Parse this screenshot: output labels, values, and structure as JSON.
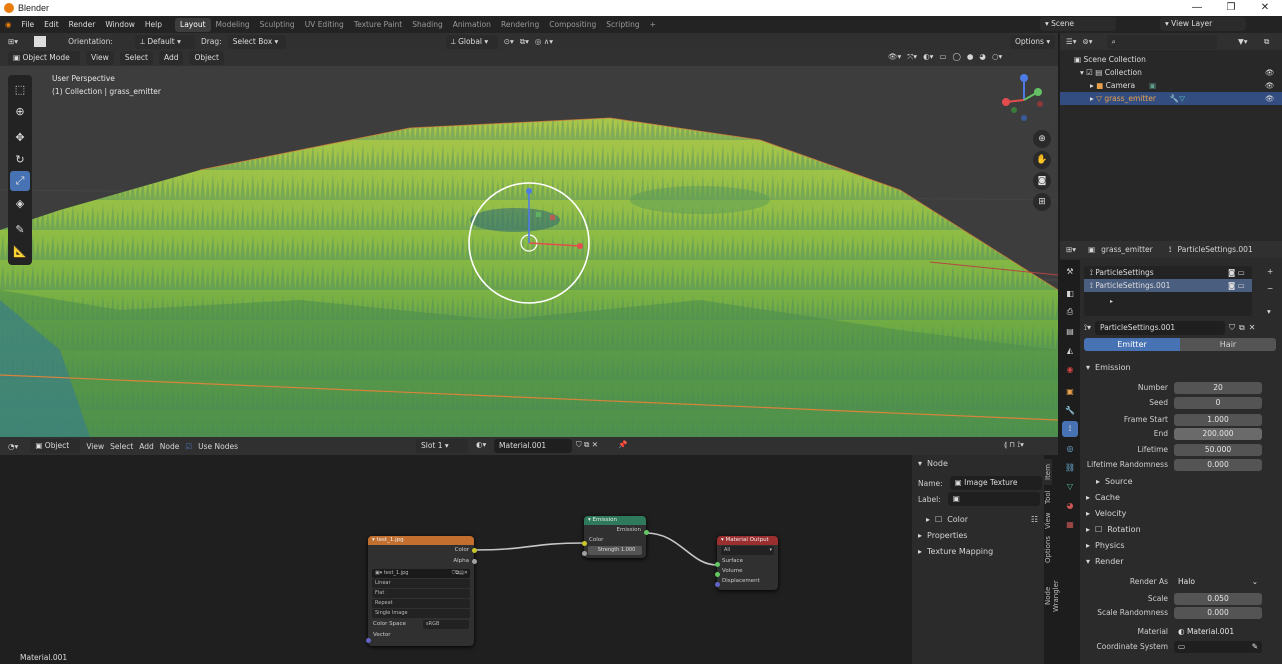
{
  "window": {
    "title": "Blender",
    "minimize": "—",
    "maximize": "❐",
    "close": "✕"
  },
  "menu": {
    "items": [
      "File",
      "Edit",
      "Render",
      "Window",
      "Help"
    ]
  },
  "workspaces": [
    "Layout",
    "Modeling",
    "Sculpting",
    "UV Editing",
    "Texture Paint",
    "Shading",
    "Animation",
    "Rendering",
    "Compositing",
    "Scripting"
  ],
  "workspace_add": "+",
  "scene": {
    "name": "Scene",
    "view_layer": "View Layer"
  },
  "tool_header": {
    "orientation_label": "Orientation:",
    "orientation_value": "Default",
    "drag_label": "Drag:",
    "drag_value": "Select Box",
    "transform": "Global",
    "options": "Options"
  },
  "viewport_header": {
    "mode": "Object Mode",
    "menus": [
      "View",
      "Select",
      "Add",
      "Object"
    ]
  },
  "viewport": {
    "perspective": "User Perspective",
    "collection": "(1) Collection | grass_emitter"
  },
  "outliner": {
    "root": "Scene Collection",
    "collection": "Collection",
    "items": [
      {
        "name": "Camera"
      },
      {
        "name": "grass_emitter"
      }
    ]
  },
  "properties": {
    "object": "grass_emitter",
    "settings": "ParticleSettings.001",
    "list": [
      "ParticleSettings",
      "ParticleSettings.001"
    ],
    "datablock": "ParticleSettings.001",
    "type_tabs": [
      "Emitter",
      "Hair"
    ],
    "emission": {
      "title": "Emission",
      "fields": [
        {
          "label": "Number",
          "value": "20"
        },
        {
          "label": "Seed",
          "value": "0"
        },
        {
          "label": "Frame Start",
          "value": "1.000"
        },
        {
          "label": "End",
          "value": "200.000"
        },
        {
          "label": "Lifetime",
          "value": "50.000"
        },
        {
          "label": "Lifetime Randomness",
          "value": "0.000"
        }
      ]
    },
    "panels": [
      "Source",
      "Cache",
      "Velocity",
      "Rotation",
      "Physics",
      "Render"
    ],
    "render": {
      "render_as_label": "Render As",
      "render_as": "Halo",
      "scale_label": "Scale",
      "scale": "0.050",
      "scale_rand_label": "Scale Randomness",
      "scale_rand": "0.000",
      "material_label": "Material",
      "material": "Material.001",
      "coord_label": "Coordinate System"
    }
  },
  "node_editor": {
    "header": {
      "mode": "Object",
      "menus": [
        "View",
        "Select",
        "Add",
        "Node"
      ],
      "use_nodes": "Use Nodes",
      "slot": "Slot 1",
      "material": "Material.001"
    },
    "footer_material": "Material.001",
    "image_node": {
      "title": "test_1.jpg",
      "out_color": "Color",
      "out_alpha": "Alpha",
      "image": "test_1.jpg",
      "interp": "Linear",
      "proj": "Flat",
      "ext": "Repeat",
      "source": "Single Image",
      "colorspace_label": "Color Space",
      "colorspace": "sRGB",
      "in_vector": "Vector"
    },
    "emission_node": {
      "title": "Emission",
      "out": "Emission",
      "in_color": "Color",
      "strength": "Strength  1.000"
    },
    "output_node": {
      "title": "Material Output",
      "target": "All",
      "in_surface": "Surface",
      "in_volume": "Volume",
      "in_disp": "Displacement"
    }
  },
  "node_panel": {
    "title": "Node",
    "name_label": "Name:",
    "name": "Image Texture",
    "label_label": "Label:",
    "color": "Color",
    "properties": "Properties",
    "texture_mapping": "Texture Mapping"
  },
  "node_tabs": [
    "Item",
    "Tool",
    "View",
    "Options",
    "Node Wrangler"
  ],
  "colors": {
    "accent": "#4772b3",
    "image_node": "#c26f30",
    "emission_node": "#2f7a5c",
    "output_node": "#9b2e2e",
    "selected_row": "#334d80"
  }
}
